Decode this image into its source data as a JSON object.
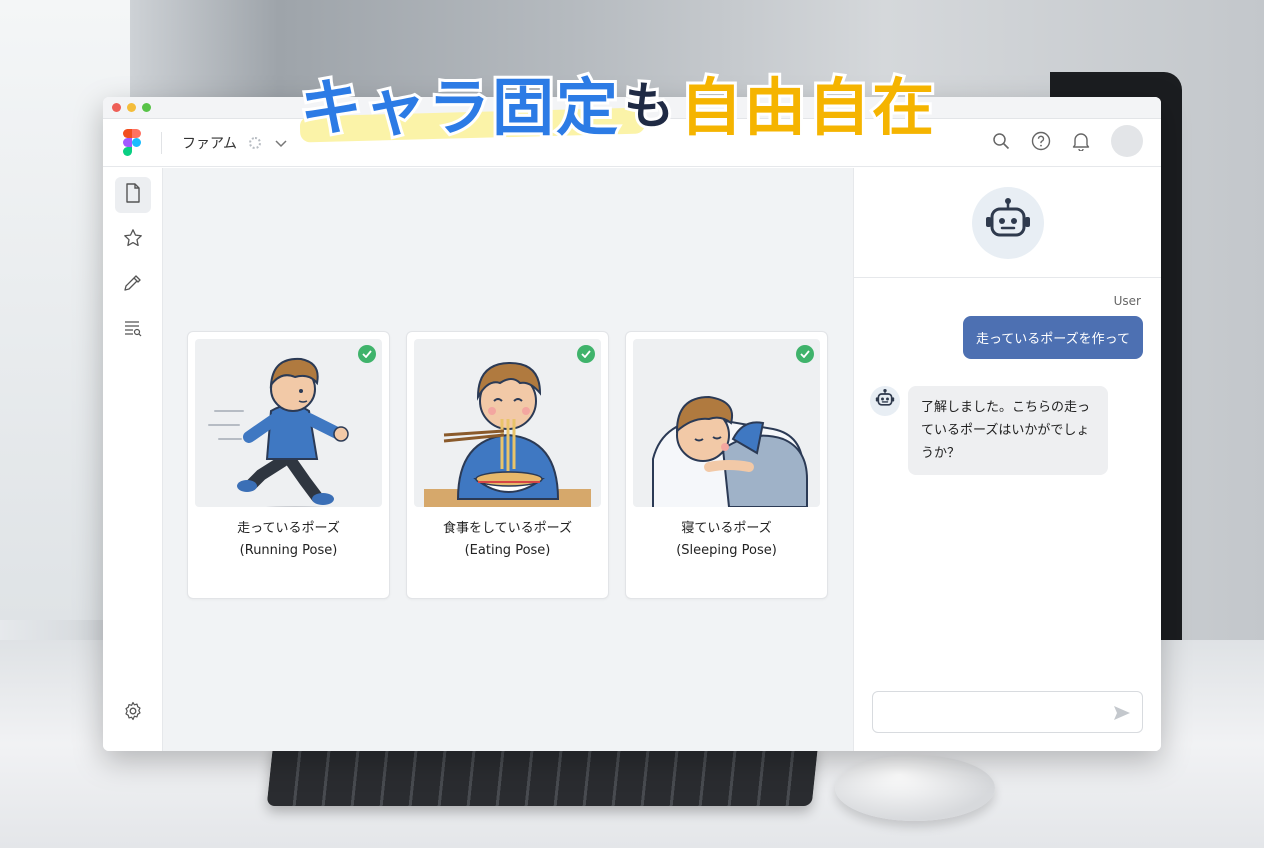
{
  "headline": {
    "part_blue": "キャラ固定",
    "part_particle": "も",
    "part_yellow": "自由自在"
  },
  "topbar": {
    "project_name": "ファアム"
  },
  "cards": [
    {
      "title_ja": "走っているポーズ",
      "title_en": "(Running Pose)"
    },
    {
      "title_ja": "食事をしているポーズ",
      "title_en": "(Eating Pose)"
    },
    {
      "title_ja": "寝ているポーズ",
      "title_en": "(Sleeping Pose)"
    }
  ],
  "chat": {
    "user_label": "User",
    "user_message": "走っているポーズを作って",
    "bot_message": "了解しました。こちらの走っているポーズはいかがでしょうか？",
    "input_value": ""
  },
  "colors": {
    "accent_blue": "#4d70b2",
    "check_green": "#3fb36b",
    "headline_blue": "#2c7be5",
    "headline_yellow": "#f5b400"
  },
  "icons": [
    "file-icon",
    "star-icon",
    "eyedropper-icon",
    "list-search-icon",
    "settings-icon",
    "search-icon",
    "help-icon",
    "bell-icon",
    "robot-icon",
    "send-icon"
  ]
}
